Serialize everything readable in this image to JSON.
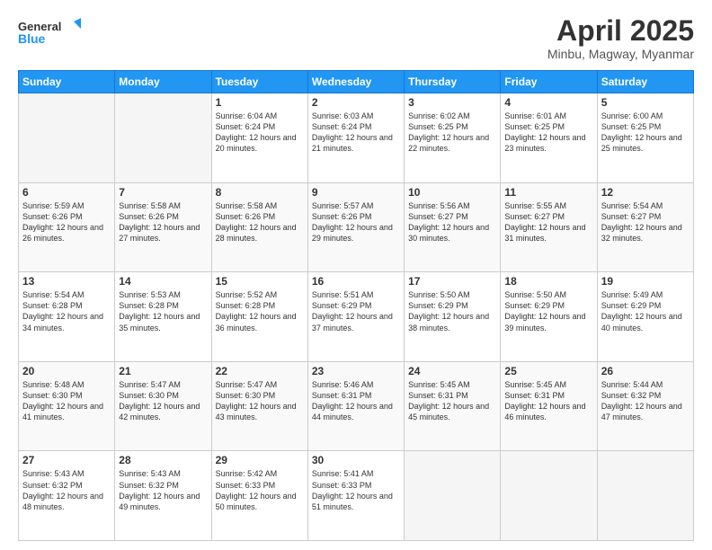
{
  "header": {
    "logo_line1": "General",
    "logo_line2": "Blue",
    "month_title": "April 2025",
    "location": "Minbu, Magway, Myanmar"
  },
  "weekdays": [
    "Sunday",
    "Monday",
    "Tuesday",
    "Wednesday",
    "Thursday",
    "Friday",
    "Saturday"
  ],
  "weeks": [
    [
      {
        "day": "",
        "info": ""
      },
      {
        "day": "",
        "info": ""
      },
      {
        "day": "1",
        "info": "Sunrise: 6:04 AM\nSunset: 6:24 PM\nDaylight: 12 hours\nand 20 minutes."
      },
      {
        "day": "2",
        "info": "Sunrise: 6:03 AM\nSunset: 6:24 PM\nDaylight: 12 hours\nand 21 minutes."
      },
      {
        "day": "3",
        "info": "Sunrise: 6:02 AM\nSunset: 6:25 PM\nDaylight: 12 hours\nand 22 minutes."
      },
      {
        "day": "4",
        "info": "Sunrise: 6:01 AM\nSunset: 6:25 PM\nDaylight: 12 hours\nand 23 minutes."
      },
      {
        "day": "5",
        "info": "Sunrise: 6:00 AM\nSunset: 6:25 PM\nDaylight: 12 hours\nand 25 minutes."
      }
    ],
    [
      {
        "day": "6",
        "info": "Sunrise: 5:59 AM\nSunset: 6:26 PM\nDaylight: 12 hours\nand 26 minutes."
      },
      {
        "day": "7",
        "info": "Sunrise: 5:58 AM\nSunset: 6:26 PM\nDaylight: 12 hours\nand 27 minutes."
      },
      {
        "day": "8",
        "info": "Sunrise: 5:58 AM\nSunset: 6:26 PM\nDaylight: 12 hours\nand 28 minutes."
      },
      {
        "day": "9",
        "info": "Sunrise: 5:57 AM\nSunset: 6:26 PM\nDaylight: 12 hours\nand 29 minutes."
      },
      {
        "day": "10",
        "info": "Sunrise: 5:56 AM\nSunset: 6:27 PM\nDaylight: 12 hours\nand 30 minutes."
      },
      {
        "day": "11",
        "info": "Sunrise: 5:55 AM\nSunset: 6:27 PM\nDaylight: 12 hours\nand 31 minutes."
      },
      {
        "day": "12",
        "info": "Sunrise: 5:54 AM\nSunset: 6:27 PM\nDaylight: 12 hours\nand 32 minutes."
      }
    ],
    [
      {
        "day": "13",
        "info": "Sunrise: 5:54 AM\nSunset: 6:28 PM\nDaylight: 12 hours\nand 34 minutes."
      },
      {
        "day": "14",
        "info": "Sunrise: 5:53 AM\nSunset: 6:28 PM\nDaylight: 12 hours\nand 35 minutes."
      },
      {
        "day": "15",
        "info": "Sunrise: 5:52 AM\nSunset: 6:28 PM\nDaylight: 12 hours\nand 36 minutes."
      },
      {
        "day": "16",
        "info": "Sunrise: 5:51 AM\nSunset: 6:29 PM\nDaylight: 12 hours\nand 37 minutes."
      },
      {
        "day": "17",
        "info": "Sunrise: 5:50 AM\nSunset: 6:29 PM\nDaylight: 12 hours\nand 38 minutes."
      },
      {
        "day": "18",
        "info": "Sunrise: 5:50 AM\nSunset: 6:29 PM\nDaylight: 12 hours\nand 39 minutes."
      },
      {
        "day": "19",
        "info": "Sunrise: 5:49 AM\nSunset: 6:29 PM\nDaylight: 12 hours\nand 40 minutes."
      }
    ],
    [
      {
        "day": "20",
        "info": "Sunrise: 5:48 AM\nSunset: 6:30 PM\nDaylight: 12 hours\nand 41 minutes."
      },
      {
        "day": "21",
        "info": "Sunrise: 5:47 AM\nSunset: 6:30 PM\nDaylight: 12 hours\nand 42 minutes."
      },
      {
        "day": "22",
        "info": "Sunrise: 5:47 AM\nSunset: 6:30 PM\nDaylight: 12 hours\nand 43 minutes."
      },
      {
        "day": "23",
        "info": "Sunrise: 5:46 AM\nSunset: 6:31 PM\nDaylight: 12 hours\nand 44 minutes."
      },
      {
        "day": "24",
        "info": "Sunrise: 5:45 AM\nSunset: 6:31 PM\nDaylight: 12 hours\nand 45 minutes."
      },
      {
        "day": "25",
        "info": "Sunrise: 5:45 AM\nSunset: 6:31 PM\nDaylight: 12 hours\nand 46 minutes."
      },
      {
        "day": "26",
        "info": "Sunrise: 5:44 AM\nSunset: 6:32 PM\nDaylight: 12 hours\nand 47 minutes."
      }
    ],
    [
      {
        "day": "27",
        "info": "Sunrise: 5:43 AM\nSunset: 6:32 PM\nDaylight: 12 hours\nand 48 minutes."
      },
      {
        "day": "28",
        "info": "Sunrise: 5:43 AM\nSunset: 6:32 PM\nDaylight: 12 hours\nand 49 minutes."
      },
      {
        "day": "29",
        "info": "Sunrise: 5:42 AM\nSunset: 6:33 PM\nDaylight: 12 hours\nand 50 minutes."
      },
      {
        "day": "30",
        "info": "Sunrise: 5:41 AM\nSunset: 6:33 PM\nDaylight: 12 hours\nand 51 minutes."
      },
      {
        "day": "",
        "info": ""
      },
      {
        "day": "",
        "info": ""
      },
      {
        "day": "",
        "info": ""
      }
    ]
  ]
}
